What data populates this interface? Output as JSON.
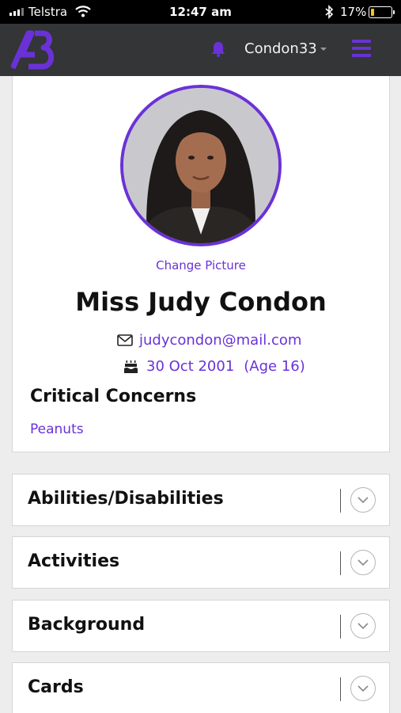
{
  "status_bar": {
    "carrier": "Telstra",
    "time": "12:47 am",
    "battery_percent": "17%",
    "battery_level": 0.17,
    "icons": [
      "signal-icon",
      "wifi-icon",
      "bluetooth-icon",
      "battery-icon"
    ]
  },
  "navbar": {
    "logo_icon": "ab-logo-icon",
    "notification_icon": "bell-icon",
    "username": "Condon33",
    "menu_icon": "hamburger-menu-icon"
  },
  "profile": {
    "change_picture_label": "Change Picture",
    "full_name": "Miss Judy Condon",
    "email": "judycondon@mail.com",
    "email_icon": "envelope-icon",
    "date_of_birth": "30 Oct 2001",
    "age": "(Age 16)",
    "birthday_icon": "birthday-cake-icon",
    "critical_concerns_title": "Critical Concerns",
    "critical_concerns": [
      "Peanuts"
    ]
  },
  "sections": [
    {
      "label": "Abilities/Disabilities"
    },
    {
      "label": "Activities"
    },
    {
      "label": "Background"
    },
    {
      "label": "Cards"
    }
  ],
  "colors": {
    "accent": "#6a32d6",
    "navbar_bg": "#333537",
    "page_bg": "#ededed",
    "battery_fill": "#f5c518"
  }
}
